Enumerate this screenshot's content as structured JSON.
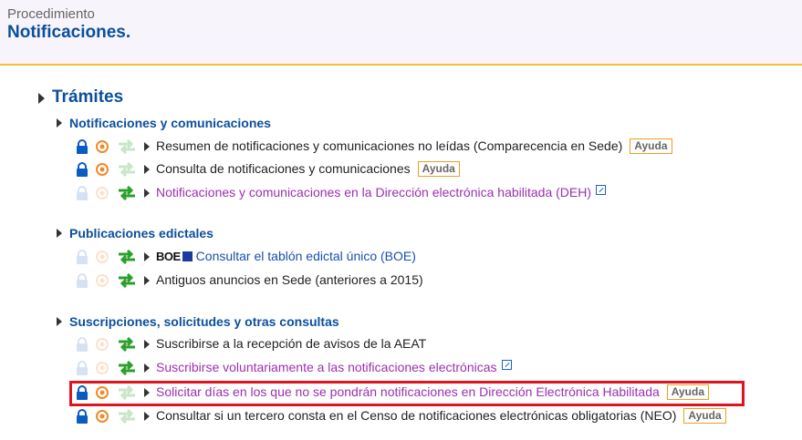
{
  "header": {
    "kicker": "Procedimiento",
    "title": "Notificaciones."
  },
  "section": {
    "title": "Trámites"
  },
  "groups": [
    {
      "title": "Notificaciones y comunicaciones",
      "items": [
        {
          "text": "Resumen de notificaciones y comunicaciones no leídas (Comparecencia en Sede)",
          "help": "Ayuda",
          "style": "plain",
          "lock": "active",
          "eye": "active",
          "arrows": "inactive"
        },
        {
          "text": "Consulta de notificaciones y comunicaciones",
          "help": "Ayuda",
          "style": "plain",
          "lock": "active",
          "eye": "active",
          "arrows": "inactive"
        },
        {
          "text": "Notificaciones y comunicaciones en la Dirección electrónica habilitada (DEH)",
          "help": "",
          "style": "link",
          "external": true,
          "lock": "inactive",
          "eye": "inactive",
          "arrows": "active"
        }
      ]
    },
    {
      "title": "Publicaciones edictales",
      "items": [
        {
          "prefix_logo": "BOE",
          "text": "Consultar el tablón edictal único (BOE)",
          "style": "blue",
          "lock": "inactive",
          "eye": "inactive",
          "arrows": "active"
        },
        {
          "text": "Antiguos anuncios en Sede (anteriores a 2015)",
          "style": "plain",
          "lock": "inactive",
          "eye": "inactive",
          "arrows": "active"
        }
      ]
    },
    {
      "title": "Suscripciones, solicitudes y otras consultas",
      "items": [
        {
          "text": "Suscribirse a la recepción de avisos de la AEAT",
          "style": "plain",
          "lock": "inactive",
          "eye": "inactive",
          "arrows": "active"
        },
        {
          "text": "Suscribirse voluntariamente a las notificaciones electrónicas",
          "style": "link",
          "external": true,
          "lock": "inactive",
          "eye": "inactive",
          "arrows": "active"
        },
        {
          "text": "Solicitar días en los que no se pondrán notificaciones en Dirección Electrónica Habilitada",
          "help": "Ayuda",
          "style": "link",
          "highlighted": true,
          "lock": "active",
          "eye": "active",
          "arrows": "inactive"
        },
        {
          "text": "Consultar si un tercero consta en el Censo de notificaciones electrónicas obligatorias (NEO)",
          "help": "Ayuda",
          "style": "plain",
          "lock": "active",
          "eye": "active",
          "arrows": "inactive"
        }
      ]
    }
  ],
  "colors": {
    "accent": "#0b4f9c",
    "link": "#9b30b0",
    "highlight": "#e0141e",
    "header_border": "#f2c12e",
    "arrows_green": "#2aa02a",
    "eye_orange": "#f08a2a"
  },
  "icons": {
    "lock": "lock-icon",
    "eye": "eye-icon",
    "arrows": "exchange-arrows-icon",
    "external": "external-link-icon"
  }
}
